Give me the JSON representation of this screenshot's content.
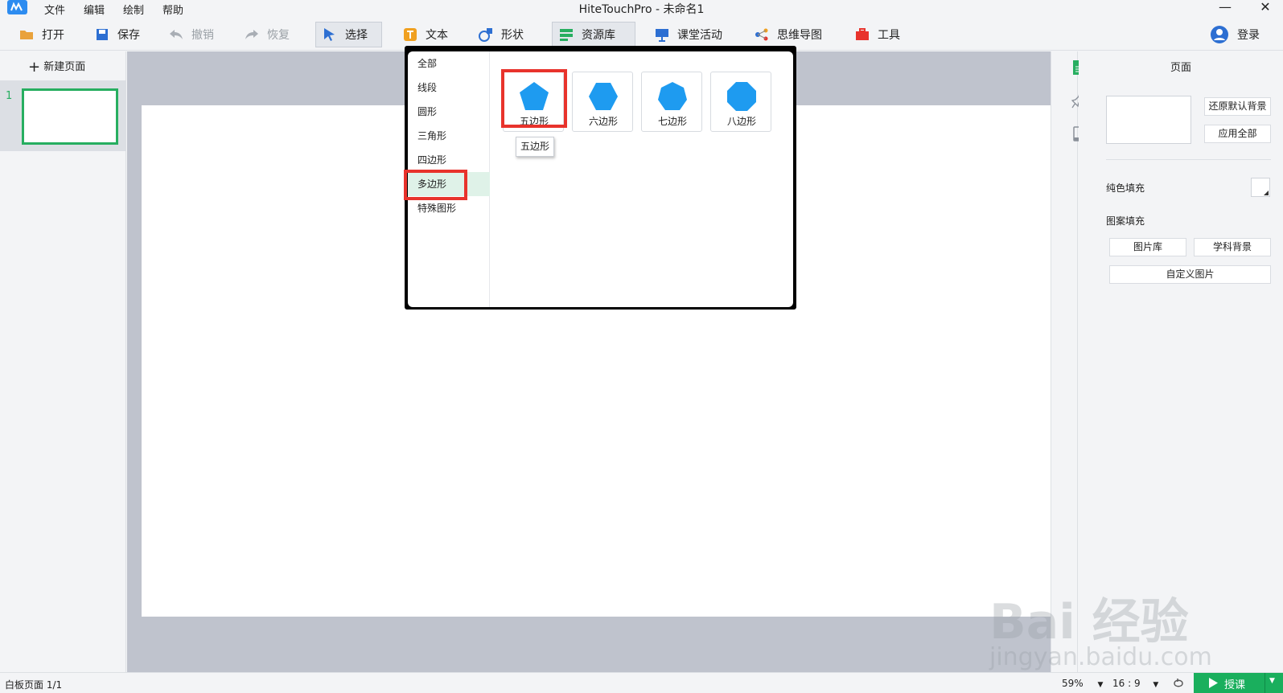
{
  "titlebar": {
    "menus": [
      "文件",
      "编辑",
      "绘制",
      "帮助"
    ],
    "title": "HiteTouchPro - 未命名1",
    "minimize": "—",
    "close": "✕"
  },
  "toolbar": {
    "open": "打开",
    "save": "保存",
    "undo": "撤销",
    "redo": "恢复",
    "select": "选择",
    "text": "文本",
    "shape": "形状",
    "resources": "资源库",
    "class_activity": "课堂活动",
    "mind_map": "思维导图",
    "tools": "工具",
    "login": "登录"
  },
  "left_pane": {
    "new_page": "新建页面",
    "pages": [
      {
        "number": "1"
      }
    ]
  },
  "dropdown": {
    "categories": [
      "全部",
      "线段",
      "圆形",
      "三角形",
      "四边形",
      "多边形",
      "特殊图形"
    ],
    "selected_category": "多边形",
    "shapes": [
      "五边形",
      "六边形",
      "七边形",
      "八边形"
    ],
    "tooltip": "五边形",
    "shape_color": "#1e9bf0"
  },
  "right_panel": {
    "title": "页面",
    "restore_default_bg": "还原默认背景",
    "apply_all": "应用全部",
    "solid_fill": "纯色填充",
    "pattern_fill": "图案填充",
    "image_library": "图片库",
    "subject_bg": "学科背景",
    "custom_image": "自定义图片"
  },
  "status": {
    "page_info": "白板页面 1/1",
    "zoom": "59%",
    "ratio": "16 : 9",
    "teach": "授课"
  },
  "colors": {
    "accent_green": "#27ae60",
    "highlight_red": "#e8332c",
    "teach_green": "#1aaf5d"
  },
  "watermark": {
    "brand": "Bai 经验",
    "url": "jingyan.baidu.com"
  }
}
